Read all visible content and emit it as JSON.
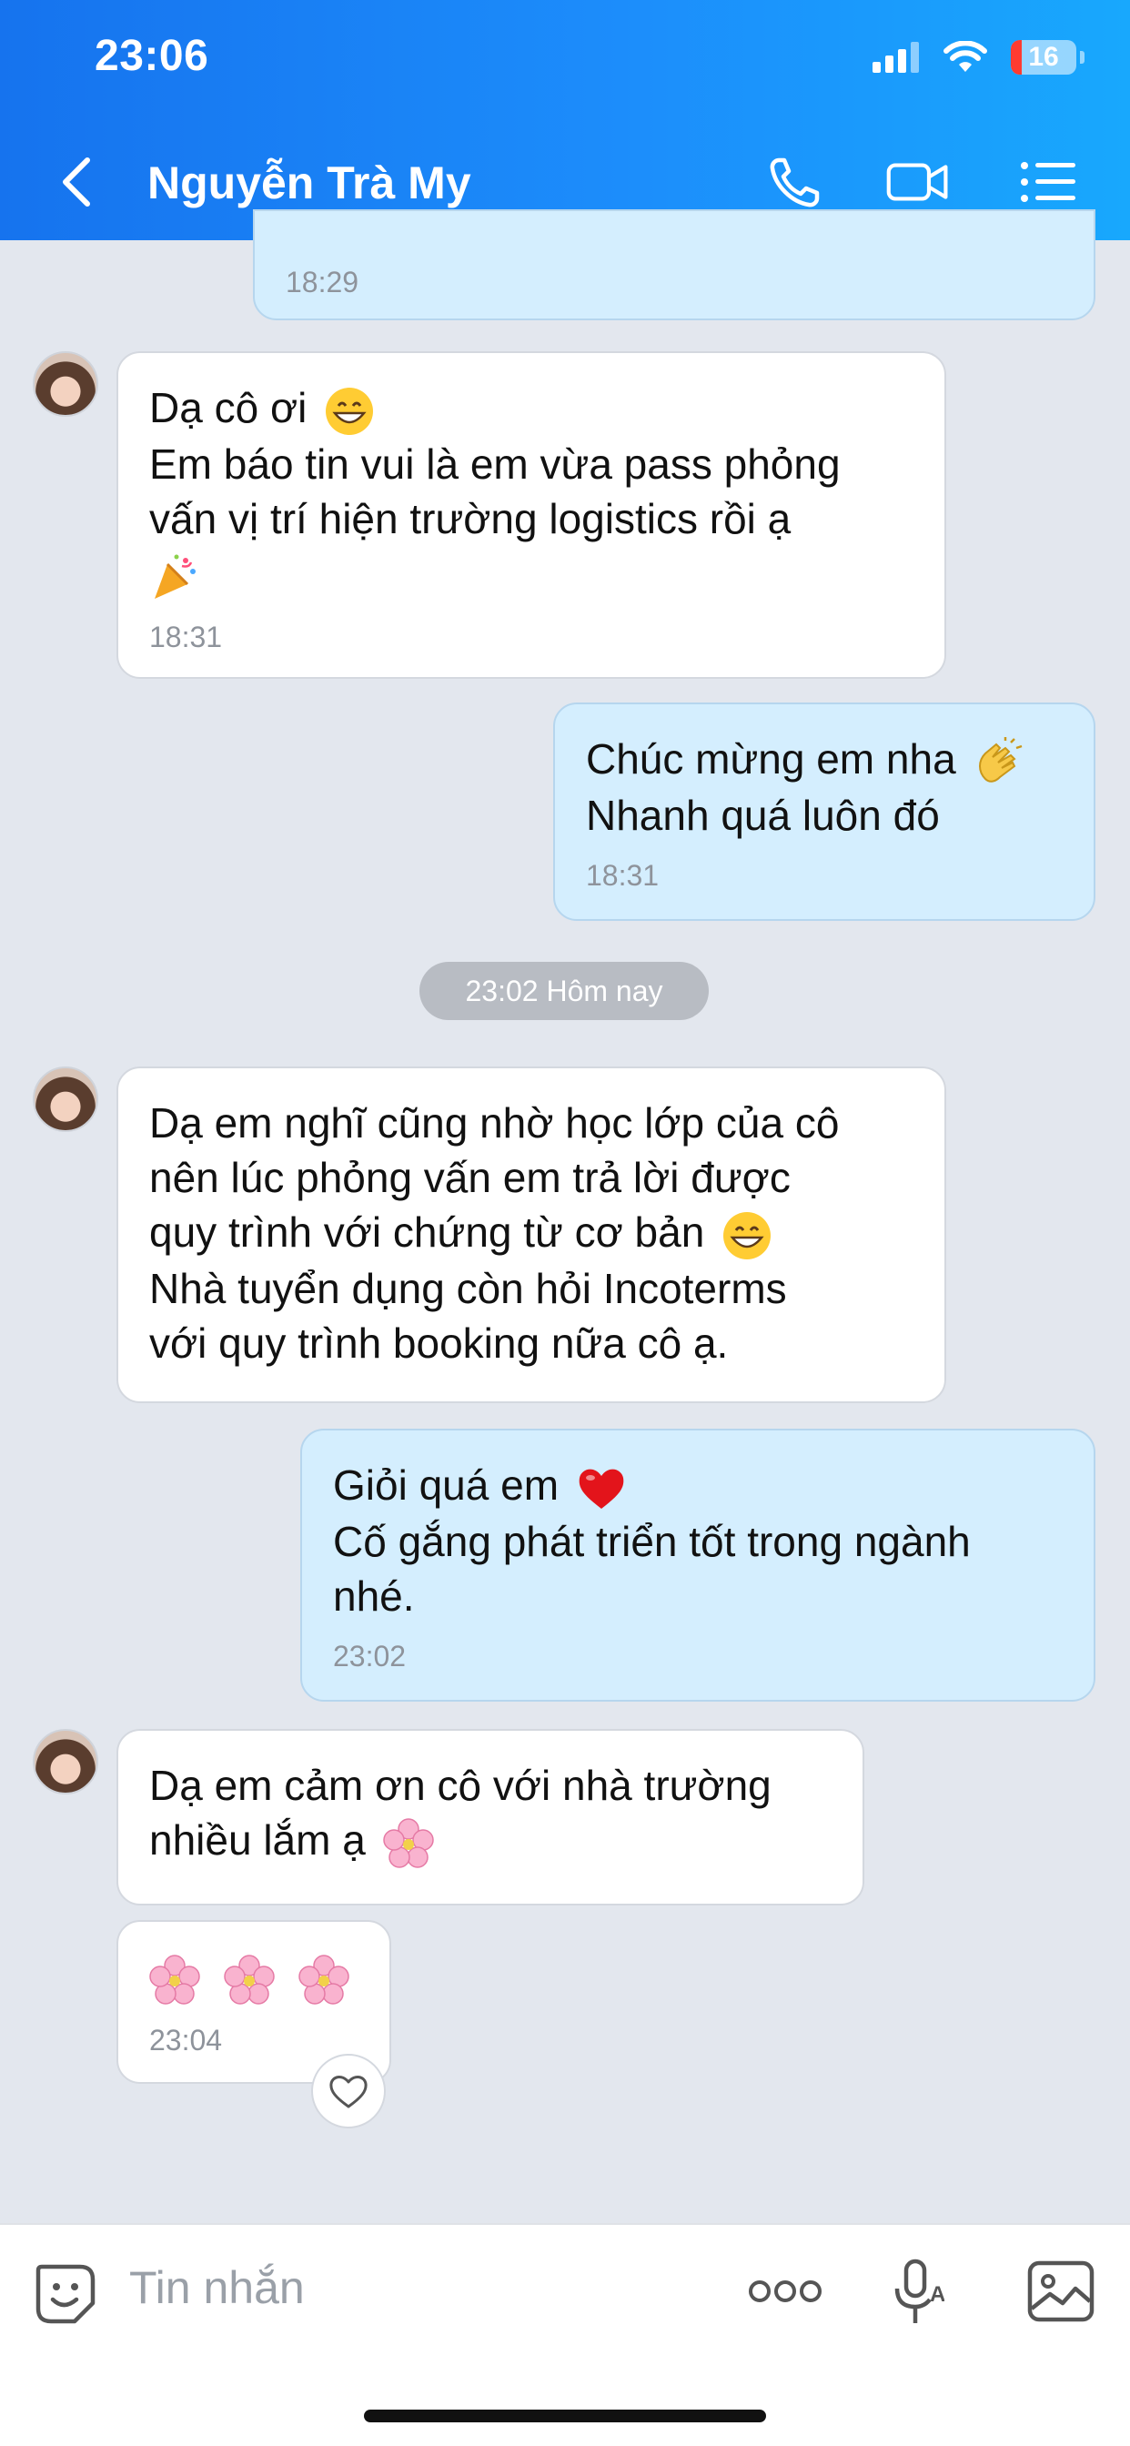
{
  "status_bar": {
    "time": "23:06",
    "battery": "16"
  },
  "header": {
    "contact_name": "Nguyễn Trà My"
  },
  "messages": [
    {
      "time": "18:29"
    },
    {
      "lines": [
        "Dạ cô ơi",
        "Em báo tin vui là em vừa pass phỏng",
        "vấn vị trí hiện trường logistics rồi ạ"
      ],
      "emoji": [
        "grinning-face",
        "party-popper"
      ],
      "time": "18:31"
    },
    {
      "lines": [
        "Chúc mừng em nha",
        "Nhanh quá luôn đó"
      ],
      "emoji": [
        "clapping-hands"
      ],
      "time": "18:31"
    },
    {
      "lines": [
        "Dạ em nghĩ cũng nhờ học lớp của cô",
        "nên lúc phỏng vấn em trả lời được",
        "quy trình với chứng từ cơ bản",
        "Nhà tuyển dụng còn hỏi Incoterms",
        "với quy trình booking nữa cô ạ."
      ],
      "emoji": [
        "grinning-face"
      ]
    },
    {
      "lines": [
        "Giỏi quá em",
        "Cố gắng phát triển tốt trong ngành",
        "nhé."
      ],
      "emoji": [
        "red-heart"
      ],
      "time": "23:02"
    },
    {
      "lines": [
        "Dạ em cảm ơn cô với nhà trường",
        "nhiều lắm ạ"
      ],
      "emoji": [
        "cherry-blossom"
      ]
    },
    {
      "emoji": [
        "cherry-blossom",
        "cherry-blossom",
        "cherry-blossom"
      ],
      "time": "23:04"
    }
  ],
  "date_separator": "23:02 Hôm nay",
  "composer": {
    "placeholder": "Tin nhắn"
  },
  "colors": {
    "header_start": "#1673ee",
    "header_end": "#18a8fd",
    "outgoing_bubble": "#d4eefe",
    "incoming_bubble": "#ffffff",
    "chat_background": "#e3e7ee"
  },
  "icons": [
    "back-chevron-icon",
    "phone-icon",
    "video-call-icon",
    "list-menu-icon",
    "sticker-icon",
    "more-dots-icon",
    "voice-text-icon",
    "image-icon",
    "heart-icon"
  ]
}
